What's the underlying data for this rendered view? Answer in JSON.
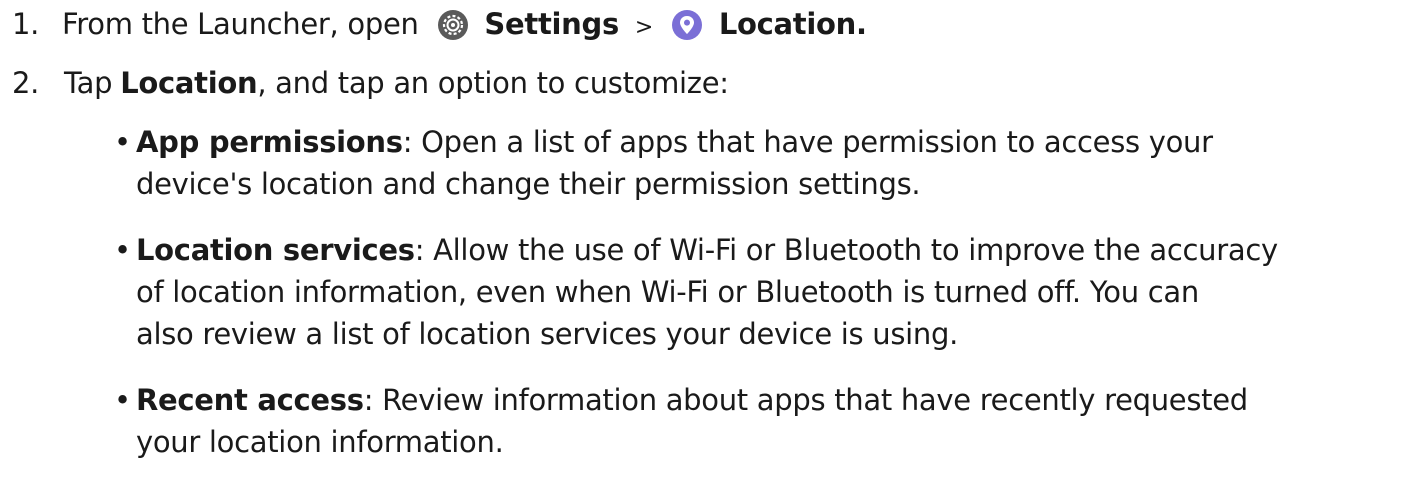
{
  "steps": [
    {
      "number": "1.",
      "prefix": "From the Launcher, open",
      "settings_icon": "gear-icon",
      "settings_label": "Settings",
      "separator": ">",
      "location_icon": "location-pin-icon",
      "location_label": "Location."
    },
    {
      "number": "2.",
      "prefix": "Tap",
      "bold": "Location",
      "suffix": ", and tap an option to customize:"
    }
  ],
  "options": [
    {
      "bullet": "•",
      "term": "App permissions",
      "colon": ":",
      "lines": [
        " Open a list of apps that have permission to access your",
        "device's location and change their permission settings."
      ]
    },
    {
      "bullet": "•",
      "term": "Location services",
      "colon": ":",
      "lines": [
        " Allow the use of Wi-Fi or Bluetooth to improve the accuracy",
        "of location information, even when Wi-Fi or Bluetooth is turned off. You can",
        "also review a list of location services your device is using."
      ]
    },
    {
      "bullet": "•",
      "term": "Recent access",
      "colon": ":",
      "lines": [
        " Review information about apps that have recently requested",
        "your location information."
      ]
    }
  ],
  "colors": {
    "settings_icon_bg": "#5a5a5a",
    "location_icon_bg": "#7b6fd6",
    "text": "#1a1a1a"
  }
}
